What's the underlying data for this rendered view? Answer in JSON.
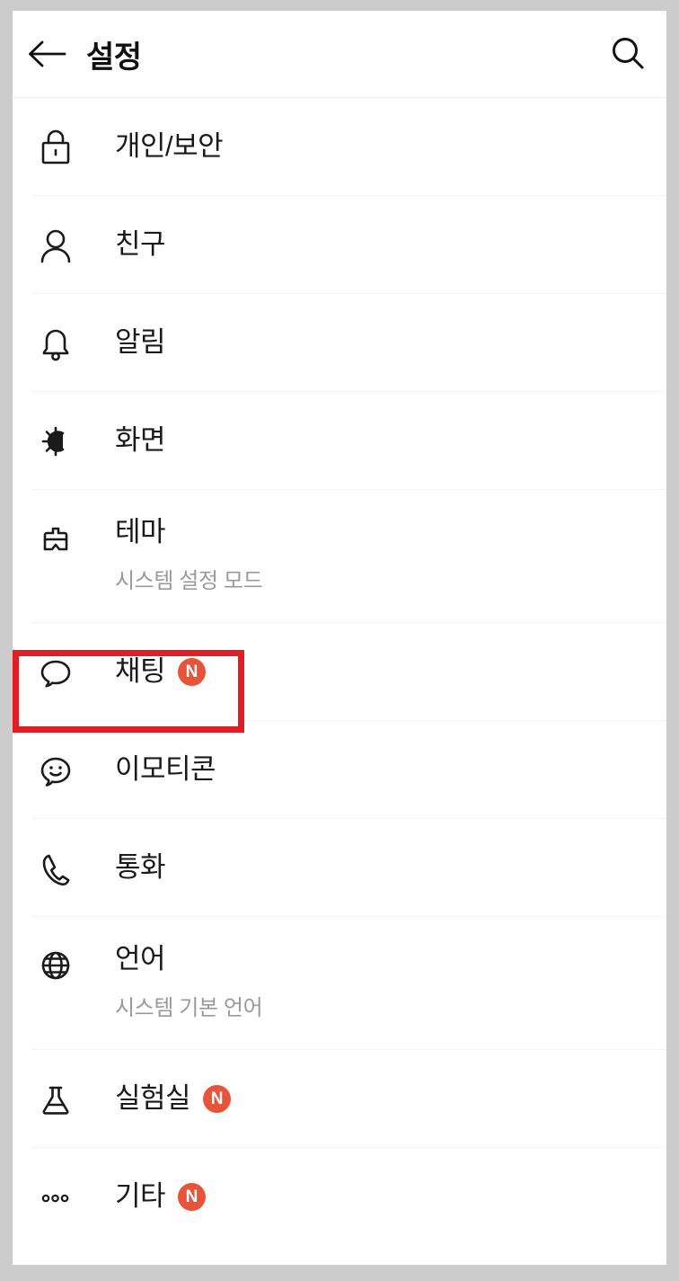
{
  "header": {
    "title": "설정",
    "back_icon": "arrow-left-icon",
    "search_icon": "search-icon"
  },
  "list": {
    "items": [
      {
        "id": "privacy",
        "label": "개인/보안",
        "icon": "lock-icon",
        "subtitle": null,
        "badge": null
      },
      {
        "id": "friends",
        "label": "친구",
        "icon": "person-icon",
        "subtitle": null,
        "badge": null
      },
      {
        "id": "alerts",
        "label": "알림",
        "icon": "bell-icon",
        "subtitle": null,
        "badge": null
      },
      {
        "id": "display",
        "label": "화면",
        "icon": "brightness-icon",
        "subtitle": null,
        "badge": null
      },
      {
        "id": "theme",
        "label": "테마",
        "icon": "paintbrush-icon",
        "subtitle": "시스템 설정 모드",
        "badge": null
      },
      {
        "id": "chat",
        "label": "채팅",
        "icon": "chat-bubble-icon",
        "subtitle": null,
        "badge": "N"
      },
      {
        "id": "emoticon",
        "label": "이모티콘",
        "icon": "smiley-bubble-icon",
        "subtitle": null,
        "badge": null
      },
      {
        "id": "call",
        "label": "통화",
        "icon": "phone-icon",
        "subtitle": null,
        "badge": null
      },
      {
        "id": "language",
        "label": "언어",
        "icon": "globe-icon",
        "subtitle": "시스템 기본 언어",
        "badge": null
      },
      {
        "id": "lab",
        "label": "실험실",
        "icon": "flask-icon",
        "subtitle": null,
        "badge": "N"
      },
      {
        "id": "etc",
        "label": "기타",
        "icon": "ellipsis-icon",
        "subtitle": null,
        "badge": "N"
      }
    ]
  },
  "annotation": {
    "target": "chat",
    "color": "#e01e25"
  },
  "colors": {
    "badge": "#e8543a",
    "page_background": "#ffffff",
    "frame": "#cccccc",
    "text_primary": "#1a1a1a",
    "text_secondary": "#9a9a9a",
    "divider": "#f4f4f4"
  }
}
